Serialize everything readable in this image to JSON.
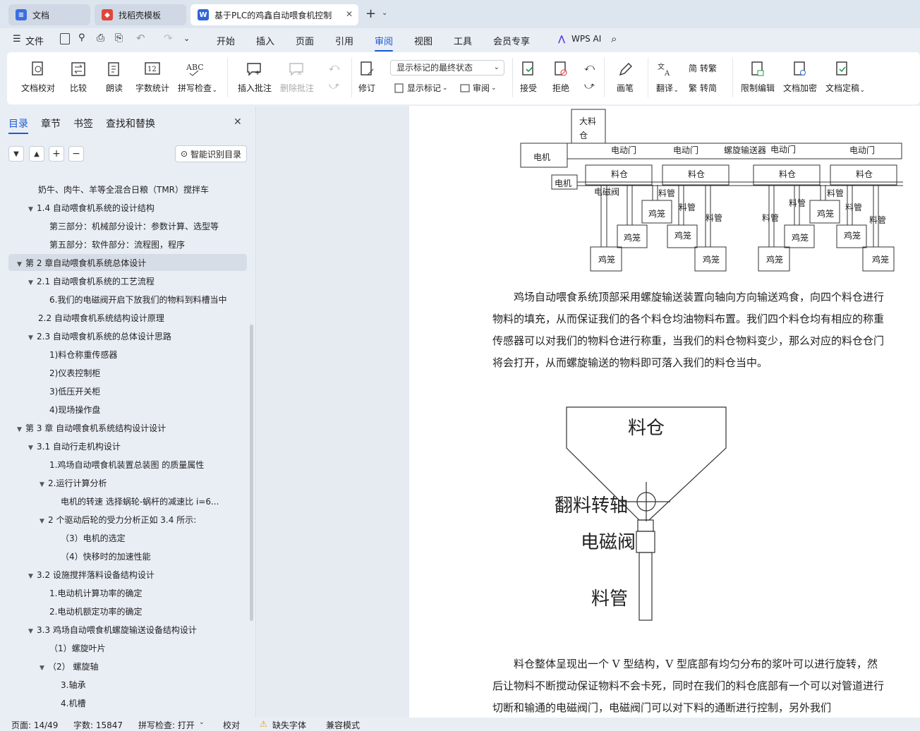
{
  "tabs": [
    {
      "label": "文档"
    },
    {
      "label": "找稻壳模板"
    },
    {
      "label": "基于PLC的鸡鑫自动喂食机控制"
    }
  ],
  "menu": {
    "file": "文件",
    "items": [
      "开始",
      "插入",
      "页面",
      "引用",
      "审阅",
      "视图",
      "工具",
      "会员专享"
    ],
    "active": "审阅",
    "wps_ai": "WPS AI"
  },
  "ribbon": {
    "proof": "文档校对",
    "compare": "比较",
    "read": "朗读",
    "wordcount": "字数统计",
    "spell": "拼写检查",
    "insert_comment": "插入批注",
    "delete_comment": "删除批注",
    "track": "修订",
    "markup_state": "显示标记的最终状态",
    "show_markup": "显示标记",
    "review": "审阅",
    "accept": "接受",
    "reject": "拒绝",
    "pen": "画笔",
    "translate": "翻译",
    "to_trad": "转繁",
    "to_simp": "转简",
    "restrict": "限制编辑",
    "encrypt": "文档加密",
    "finalize": "文档定稿"
  },
  "sidebar": {
    "tabs": [
      "目录",
      "章节",
      "书签",
      "查找和替换"
    ],
    "smart_toc": "智能识别目录",
    "toc": [
      {
        "text": "奶牛、肉牛、羊等全混合日粮（TMR）搅拌车",
        "level": 2,
        "arrow": ""
      },
      {
        "text": "1.4  自动喂食机系统的设计结构",
        "level": 2,
        "arrow": "▼"
      },
      {
        "text": "第三部分：机械部分设计：参数计算、选型等",
        "level": 3,
        "arrow": ""
      },
      {
        "text": "第五部分：软件部分：流程图，程序",
        "level": 3,
        "arrow": ""
      },
      {
        "text": "第 2 章自动喂食机系统总体设计",
        "level": 1,
        "arrow": "▼"
      },
      {
        "text": "2.1 自动喂食机系统的工艺流程",
        "level": 2,
        "arrow": "▼"
      },
      {
        "text": "6.我们的电磁阀开启下放我们的物料到料槽当中",
        "level": 3,
        "arrow": ""
      },
      {
        "text": "2.2 自动喂食机系统结构设计原理",
        "level": 2,
        "arrow": ""
      },
      {
        "text": "2.3 自动喂食机系统的总体设计思路",
        "level": 2,
        "arrow": "▼"
      },
      {
        "text": "1)料仓称重传感器",
        "level": 3,
        "arrow": ""
      },
      {
        "text": " 2)仪表控制柜",
        "level": 3,
        "arrow": ""
      },
      {
        "text": "3)低压开关柜",
        "level": 3,
        "arrow": ""
      },
      {
        "text": "4)现场操作盘",
        "level": 3,
        "arrow": ""
      },
      {
        "text": "第 3 章  自动喂食机系统结构设计设计",
        "level": 1,
        "arrow": "▼"
      },
      {
        "text": "3.1 自动行走机构设计",
        "level": 2,
        "arrow": "▼"
      },
      {
        "text": "1.鸡场自动喂食机装置总装图  的质量属性",
        "level": 3,
        "arrow": ""
      },
      {
        "text": "2.运行计算分析",
        "level": 3,
        "arrow": "▼"
      },
      {
        "text": "电机的转速         选择蜗轮-蜗杆的减速比 i=6...",
        "level": 4,
        "arrow": ""
      },
      {
        "text": "2 个驱动后轮的受力分析正如 3.4 所示:",
        "level": 3,
        "arrow": "▼"
      },
      {
        "text": "（3）电机的选定",
        "level": 4,
        "arrow": ""
      },
      {
        "text": "（4）快移时的加速性能",
        "level": 4,
        "arrow": ""
      },
      {
        "text": "3.2 设施搅拌落料设备结构设计",
        "level": 2,
        "arrow": "▼"
      },
      {
        "text": "1.电动机计算功率的确定",
        "level": 3,
        "arrow": ""
      },
      {
        "text": "2.电动机额定功率的确定",
        "level": 3,
        "arrow": ""
      },
      {
        "text": "3.3 鸡场自动喂食机螺旋输送设备结构设计",
        "level": 2,
        "arrow": "▼"
      },
      {
        "text": "（1）螺旋叶片",
        "level": 3,
        "arrow": ""
      },
      {
        "text": "（2）   螺旋轴",
        "level": 3,
        "arrow": "▼"
      },
      {
        "text": "3.轴承",
        "level": 4,
        "arrow": ""
      },
      {
        "text": "4.机槽",
        "level": 4,
        "arrow": ""
      }
    ]
  },
  "figure1": {
    "big_bin": "大料仓",
    "motor": "电机",
    "door": "电动门",
    "screw": "螺旋输送器",
    "bin": "料仓",
    "pipe": "料管",
    "cage": "鸡笼",
    "valve": "电磁阀"
  },
  "para1": "鸡场自动喂食系统顶部采用螺旋输送装置向轴向方向输送鸡食，向四个料仓进行物料的填充，从而保证我们的各个料仓均油物料布置。我们四个料仓均有相应的称重传感器可以对我们的物料仓进行称重，当我们的料仓物料变少，那么对应的料仓仓门将会打开，从而螺旋输送的物料即可落入我们的料仓当中。",
  "figure2": {
    "bin": "料仓",
    "shaft": "翻料转轴",
    "valve": "电磁阀",
    "pipe": "料管"
  },
  "para2": "料仓整体呈现出一个 V 型结构，V 型底部有均匀分布的浆叶可以进行旋转，然后让物料不断搅动保证物料不会卡死，同时在我们的料仓底部有一个可以对管道进行切断和输通的电磁阀门，电磁阀门可以对下料的通断进行控制，另外我们",
  "status": {
    "page": "页面: 14/49",
    "words": "字数: 15847",
    "spell": "拼写检查: 打开",
    "proof": "校对",
    "missing_font": "缺失字体",
    "compat": "兼容模式"
  }
}
